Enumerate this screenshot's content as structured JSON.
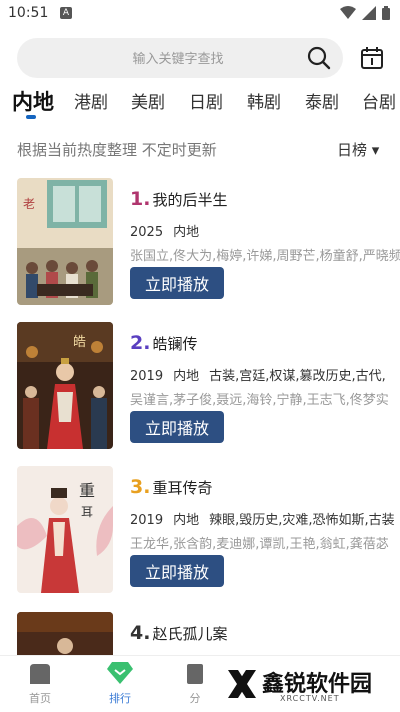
{
  "status_bar": {
    "time": "10:51",
    "notification_badge": "A"
  },
  "search": {
    "placeholder": "输入关键字查找"
  },
  "tabs": [
    {
      "label": "内地",
      "active": true
    },
    {
      "label": "港剧"
    },
    {
      "label": "美剧"
    },
    {
      "label": "日剧"
    },
    {
      "label": "韩剧"
    },
    {
      "label": "泰剧"
    },
    {
      "label": "台剧"
    }
  ],
  "subtitle": "根据当前热度整理 不定时更新",
  "rank_filter": {
    "label": "日榜 ▾"
  },
  "items": [
    {
      "rank": "1",
      "rank_color": "#b0356e",
      "title": "我的后半生",
      "year": "2025",
      "region": "内地",
      "tags": "",
      "cast": "张国立,佟大为,梅婷,许娣,周野芒,杨童舒,严晓频",
      "play": "立即播放"
    },
    {
      "rank": "2",
      "rank_color": "#5a3fc0",
      "title": "皓镧传",
      "year": "2019",
      "region": "内地",
      "tags": "古装,宫廷,权谋,篡改历史,古代,",
      "cast": "吴谨言,茅子俊,聂远,海铃,宁静,王志飞,佟梦实",
      "play": "立即播放"
    },
    {
      "rank": "3",
      "rank_color": "#e8a020",
      "title": "重耳传奇",
      "year": "2019",
      "region": "内地",
      "tags": "辣眼,毁历史,灾难,恐怖如斯,古装",
      "cast": "王龙华,张含韵,麦迪娜,谭凯,王艳,翁虹,龚蓓苾",
      "play": "立即播放"
    },
    {
      "rank": "4",
      "rank_color": "#333333",
      "title": "赵氏孤儿案",
      "year": "",
      "region": "",
      "tags": "",
      "cast": "",
      "play": ""
    }
  ],
  "bottom_nav": [
    {
      "label": "首页"
    },
    {
      "label": "排行",
      "active": true
    },
    {
      "label": "分"
    }
  ],
  "watermark": {
    "text": "鑫锐软件园",
    "sub": "XRCCTV.NET"
  }
}
